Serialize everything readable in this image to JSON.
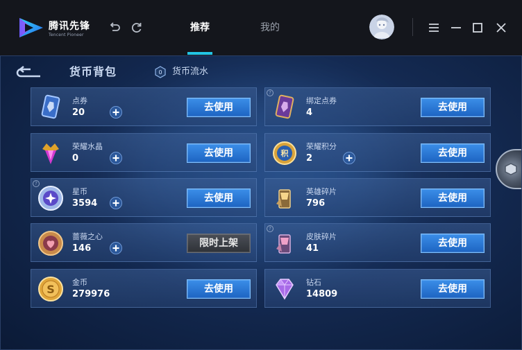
{
  "app": {
    "brand_cn": "腾讯先锋",
    "brand_en": "Tencent Pioneer",
    "tabs": [
      {
        "label": "推荐",
        "active": true
      },
      {
        "label": "我的",
        "active": false
      }
    ],
    "accent_color": "#22c4e4"
  },
  "wallet": {
    "title": "货币背包",
    "flow_label": "货币流水",
    "items": [
      {
        "name": "点券",
        "amount": "20",
        "icon": "coupon-card-icon",
        "plus": true,
        "button": "去使用",
        "enabled": true
      },
      {
        "name": "绑定点券",
        "amount": "4",
        "icon": "bound-coupon-card-icon",
        "plus": false,
        "button": "去使用",
        "enabled": true,
        "info": "?"
      },
      {
        "name": "荣耀水晶",
        "amount": "0",
        "icon": "glory-crystal-icon",
        "plus": true,
        "button": "去使用",
        "enabled": true
      },
      {
        "name": "荣耀积分",
        "amount": "2",
        "icon": "glory-points-icon",
        "plus": true,
        "button": "去使用",
        "enabled": true
      },
      {
        "name": "星币",
        "amount": "3594",
        "icon": "star-coin-icon",
        "plus": true,
        "button": "去使用",
        "enabled": true,
        "info": "?"
      },
      {
        "name": "英雄碎片",
        "amount": "796",
        "icon": "hero-fragment-icon",
        "plus": false,
        "button": "去使用",
        "enabled": true
      },
      {
        "name": "蔷薇之心",
        "amount": "146",
        "icon": "rose-heart-icon",
        "plus": true,
        "button": "限时上架",
        "enabled": false
      },
      {
        "name": "皮肤碎片",
        "amount": "41",
        "icon": "skin-fragment-icon",
        "plus": false,
        "button": "去使用",
        "enabled": true,
        "info": "?"
      },
      {
        "name": "金币",
        "amount": "279976",
        "icon": "gold-coin-icon",
        "plus": false,
        "button": "去使用",
        "enabled": true
      },
      {
        "name": "钻石",
        "amount": "14809",
        "icon": "diamond-icon",
        "plus": false,
        "button": "去使用",
        "enabled": true
      }
    ]
  }
}
